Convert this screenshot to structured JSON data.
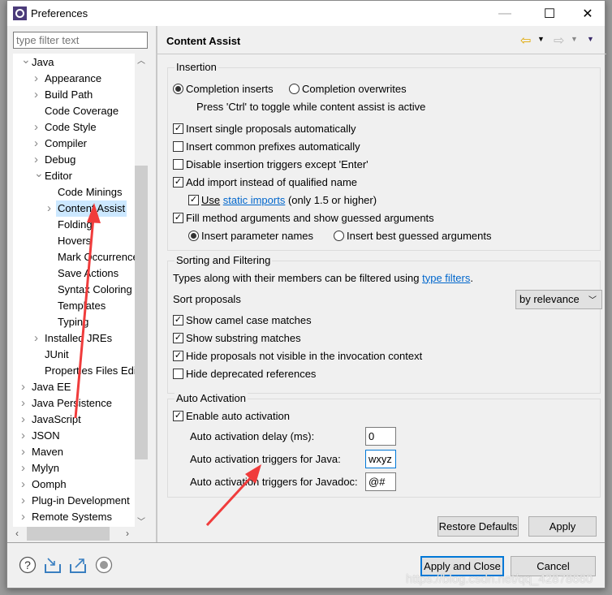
{
  "window": {
    "title": "Preferences"
  },
  "filter": {
    "placeholder": "type filter text"
  },
  "tree": {
    "items": [
      {
        "label": "Java",
        "depth": 0,
        "expanded": true
      },
      {
        "label": "Appearance",
        "depth": 1
      },
      {
        "label": "Build Path",
        "depth": 1
      },
      {
        "label": "Code Coverage",
        "depth": 1,
        "leaf": true
      },
      {
        "label": "Code Style",
        "depth": 1
      },
      {
        "label": "Compiler",
        "depth": 1
      },
      {
        "label": "Debug",
        "depth": 1
      },
      {
        "label": "Editor",
        "depth": 1,
        "expanded": true
      },
      {
        "label": "Code Minings",
        "depth": 2,
        "leaf": true
      },
      {
        "label": "Content Assist",
        "depth": 2,
        "selected": true
      },
      {
        "label": "Folding",
        "depth": 2,
        "leaf": true
      },
      {
        "label": "Hovers",
        "depth": 2,
        "leaf": true
      },
      {
        "label": "Mark Occurrences",
        "depth": 2,
        "leaf": true
      },
      {
        "label": "Save Actions",
        "depth": 2,
        "leaf": true
      },
      {
        "label": "Syntax Coloring",
        "depth": 2,
        "leaf": true
      },
      {
        "label": "Templates",
        "depth": 2,
        "leaf": true
      },
      {
        "label": "Typing",
        "depth": 2,
        "leaf": true
      },
      {
        "label": "Installed JREs",
        "depth": 1
      },
      {
        "label": "JUnit",
        "depth": 1,
        "leaf": true
      },
      {
        "label": "Properties Files Editor",
        "depth": 1,
        "leaf": true
      },
      {
        "label": "Java EE",
        "depth": 0
      },
      {
        "label": "Java Persistence",
        "depth": 0
      },
      {
        "label": "JavaScript",
        "depth": 0
      },
      {
        "label": "JSON",
        "depth": 0
      },
      {
        "label": "Maven",
        "depth": 0
      },
      {
        "label": "Mylyn",
        "depth": 0
      },
      {
        "label": "Oomph",
        "depth": 0
      },
      {
        "label": "Plug-in Development",
        "depth": 0
      },
      {
        "label": "Remote Systems",
        "depth": 0
      }
    ]
  },
  "page": {
    "title": "Content Assist"
  },
  "insertion": {
    "title": "Insertion",
    "completion_inserts": "Completion inserts",
    "completion_overwrites": "Completion overwrites",
    "completion_mode": "inserts",
    "hint": "Press 'Ctrl' to toggle while content assist is active",
    "single_proposals": {
      "label": "Insert single proposals automatically",
      "checked": true
    },
    "common_prefixes": {
      "label": "Insert common prefixes automatically",
      "checked": false
    },
    "disable_triggers": {
      "label": "Disable insertion triggers except 'Enter'",
      "checked": false
    },
    "add_import": {
      "label": "Add import instead of qualified name",
      "checked": true
    },
    "static_imports": {
      "prefix": "Use",
      "link": "static imports",
      "suffix": "(only 1.5 or higher)",
      "checked": true
    },
    "fill_args": {
      "label": "Fill method arguments and show guessed arguments",
      "checked": true
    },
    "param_names": "Insert parameter names",
    "best_guessed": "Insert best guessed arguments",
    "arg_mode": "param_names"
  },
  "sorting": {
    "title": "Sorting and Filtering",
    "desc_prefix": "Types along with their members can be filtered using",
    "desc_link": "type filters",
    "desc_suffix": ".",
    "sort_label": "Sort proposals",
    "sort_value": "by relevance",
    "camel": {
      "label": "Show camel case matches",
      "checked": true
    },
    "substring": {
      "label": "Show substring matches",
      "checked": true
    },
    "hide_invisible": {
      "label": "Hide proposals not visible in the invocation context",
      "checked": true
    },
    "hide_deprecated": {
      "label": "Hide deprecated references",
      "checked": false
    }
  },
  "auto": {
    "title": "Auto Activation",
    "enable": {
      "label": "Enable auto activation",
      "checked": true
    },
    "delay_label": "Auto activation delay (ms):",
    "delay_value": "0",
    "java_label": "Auto activation triggers for Java:",
    "java_value": "wxyz",
    "javadoc_label": "Auto activation triggers for Javadoc:",
    "javadoc_value": "@#"
  },
  "buttons": {
    "restore": "Restore Defaults",
    "apply": "Apply",
    "apply_close": "Apply and Close",
    "cancel": "Cancel"
  },
  "watermark": "https://blog.csdn.net/qq_42878660",
  "colors": {
    "accent": "#0078d7",
    "link": "#0066cc",
    "selection": "#cce8ff",
    "annotation_arrow": "#f03c3c"
  }
}
